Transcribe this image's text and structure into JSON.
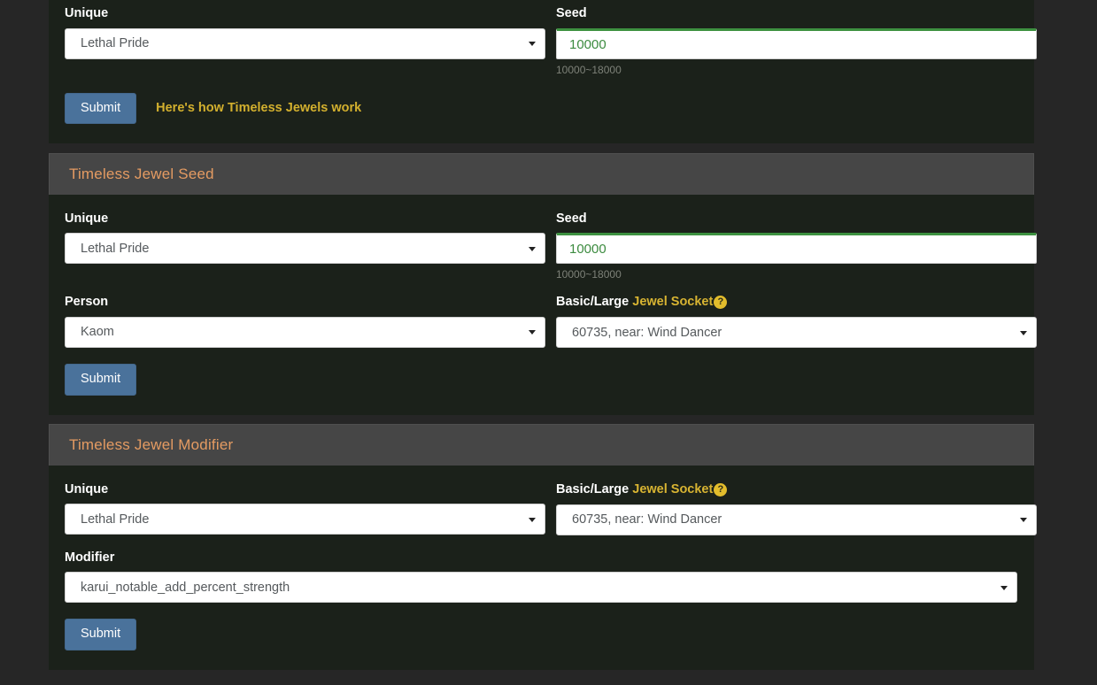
{
  "colors": {
    "page_bg": "#262626",
    "panel_bg": "#1b211a",
    "panel_header_bg": "#464646",
    "panel_header_text": "#e49b62",
    "accent_gold": "#d3b02e",
    "seed_green": "#3c8b3f",
    "submit_blue": "#4a729b"
  },
  "panels": [
    {
      "id": "timeless-jewel-top",
      "header": null,
      "fields": {
        "unique_label": "Unique",
        "unique_value": "Lethal Pride",
        "seed_label": "Seed",
        "seed_value": "10000",
        "seed_placeholder": "10000",
        "seed_helper": "10000~18000"
      },
      "submit_label": "Submit",
      "link_label": "Here's how Timeless Jewels work"
    },
    {
      "id": "timeless-jewel-seed",
      "header": "Timeless Jewel Seed",
      "fields": {
        "unique_label": "Unique",
        "unique_value": "Lethal Pride",
        "seed_label": "Seed",
        "seed_value": "10000",
        "seed_placeholder": "10000",
        "seed_helper": "10000~18000",
        "person_label": "Person",
        "person_value": "Kaom",
        "socket_label_prefix": "Basic/Large",
        "socket_label_accent": "Jewel Socket",
        "socket_help_glyph": "?",
        "socket_value": "60735, near: Wind Dancer"
      },
      "submit_label": "Submit"
    },
    {
      "id": "timeless-jewel-modifier",
      "header": "Timeless Jewel Modifier",
      "fields": {
        "unique_label": "Unique",
        "unique_value": "Lethal Pride",
        "socket_label_prefix": "Basic/Large",
        "socket_label_accent": "Jewel Socket",
        "socket_help_glyph": "?",
        "socket_value": "60735, near: Wind Dancer",
        "modifier_label": "Modifier",
        "modifier_value": "karui_notable_add_percent_strength"
      },
      "submit_label": "Submit"
    }
  ]
}
